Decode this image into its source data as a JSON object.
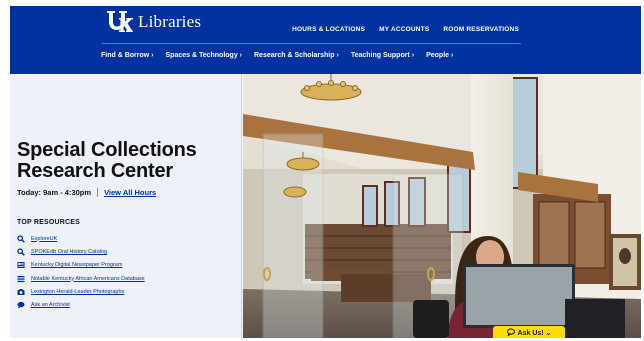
{
  "header": {
    "logo_text": "Libraries",
    "top_links": [
      "HOURS & LOCATIONS",
      "MY ACCOUNTS",
      "ROOM RESERVATIONS"
    ],
    "nav": [
      "Find & Borrow ›",
      "Spaces & Technology ›",
      "Research & Scholarship ›",
      "Teaching Support ›",
      "People ›"
    ]
  },
  "page": {
    "title": "Special Collections Research Center",
    "hours_text": "Today: 9am - 4:30pm",
    "hours_link": "View All Hours"
  },
  "resources": {
    "heading": "TOP RESOURCES",
    "items": [
      {
        "icon": "search-icon",
        "label": "ExploreUK"
      },
      {
        "icon": "search-icon",
        "label": "SPOKEdb Oral History Catalog"
      },
      {
        "icon": "newspaper-icon",
        "label": "Kentucky Digital Newspaper Program"
      },
      {
        "icon": "list-icon",
        "label": "Notable Kentucky African Americans Database"
      },
      {
        "icon": "camera-icon",
        "label": "Lexington Herald-Leader Photographs"
      },
      {
        "icon": "chat-icon",
        "label": "Ask an Archivist"
      }
    ]
  },
  "ask_widget": {
    "label": "Ask Us! ⌄",
    "icon": "chat-icon"
  },
  "colors": {
    "brand_blue": "#0033a0",
    "ask_yellow": "#ffdc00"
  }
}
